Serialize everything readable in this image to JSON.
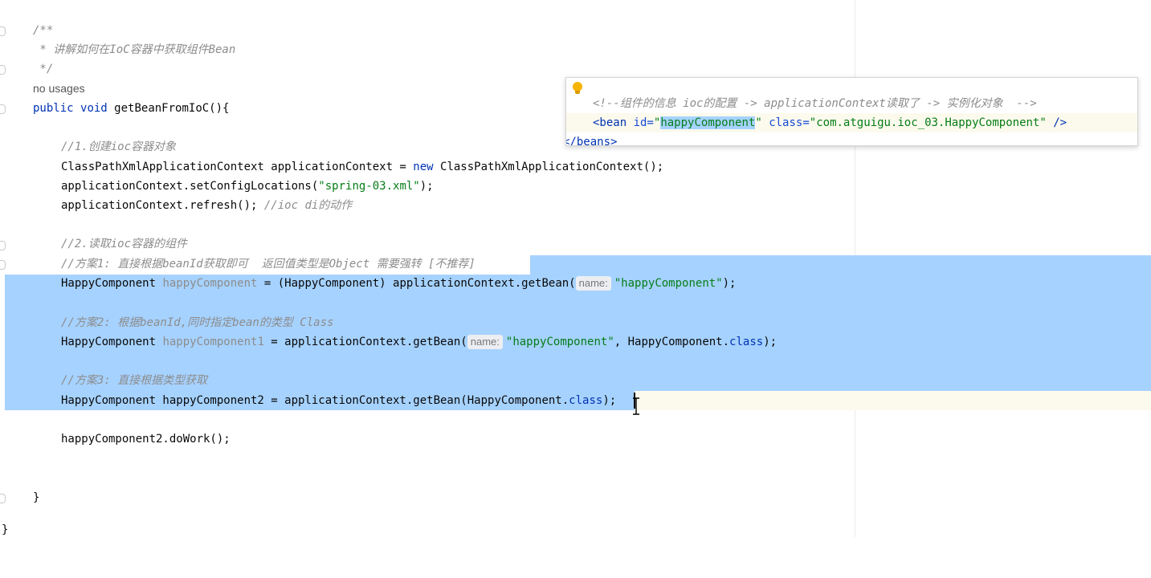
{
  "editor": {
    "javadoc": {
      "open": "/**",
      "body": " * 讲解如何在IoC容器中获取组件Bean",
      "close": " */"
    },
    "usages": "no usages",
    "method": {
      "kw_public": "public",
      "kw_void": "void",
      "signature": "getBeanFromIoC(){"
    },
    "comment_step1": "//1.创建ioc容器对象",
    "line_create": {
      "type": "ClassPathXmlApplicationContext applicationContext = ",
      "kw_new": "new",
      "rest": " ClassPathXmlApplicationContext();"
    },
    "line_config": {
      "prefix": "applicationContext.setConfigLocations(",
      "str": "\"spring-03.xml\"",
      "suffix": ");"
    },
    "line_refresh": {
      "code": "applicationContext.refresh(); ",
      "comment": "//ioc di的动作"
    },
    "comment_step2": "//2.读取ioc容器的组件",
    "comment_plan1": "//方案1: 直接根据beanId获取即可  返回值类型是Object 需要强转 [不推荐]",
    "line_plan1": {
      "type": "HappyComponent ",
      "var": "happyComponent",
      "mid": " = (HappyComponent) applicationContext.getBean(",
      "hint": "name:",
      "str": "\"happyComponent\"",
      "suffix": ");"
    },
    "comment_plan2": "//方案2: 根据beanId,同时指定bean的类型 Class",
    "line_plan2": {
      "type": "HappyComponent ",
      "var": "happyComponent1",
      "mid": " = applicationContext.getBean(",
      "hint": "name:",
      "str": "\"happyComponent\"",
      "mid2": ", HappyComponent.",
      "kw_class": "class",
      "suffix": ");"
    },
    "comment_plan3": "//方案3: 直接根据类型获取",
    "line_plan3": {
      "code": "HappyComponent happyComponent2 = applicationContext.getBean(HappyComponent.",
      "kw_class": "class",
      "suffix": ");"
    },
    "line_dowork": "happyComponent2.doWork();",
    "close_method": "}",
    "close_class": "}"
  },
  "popup": {
    "comment": "<!--组件的信息 ioc的配置 -> applicationContext读取了 -> 实例化对象  -->",
    "bean": {
      "open": "<bean ",
      "id_attr": "id=",
      "id_q1": "\"",
      "id_value": "happyComponent",
      "id_q2": "\"",
      "class_attr": " class=",
      "class_value": "\"com.atguigu.ioc_03.HappyComponent\"",
      "close": " />"
    },
    "beans_close": "</beans>"
  },
  "colors": {
    "keyword": "#0033b3",
    "string": "#067d17",
    "comment": "#8c8c8c",
    "selection": "#a6d2ff",
    "caret_row": "#fcfaed"
  },
  "icons": {
    "popup_intention": "lightbulb-icon",
    "gutter": "fold-marker-icon",
    "mouse": "text-cursor-icon"
  }
}
